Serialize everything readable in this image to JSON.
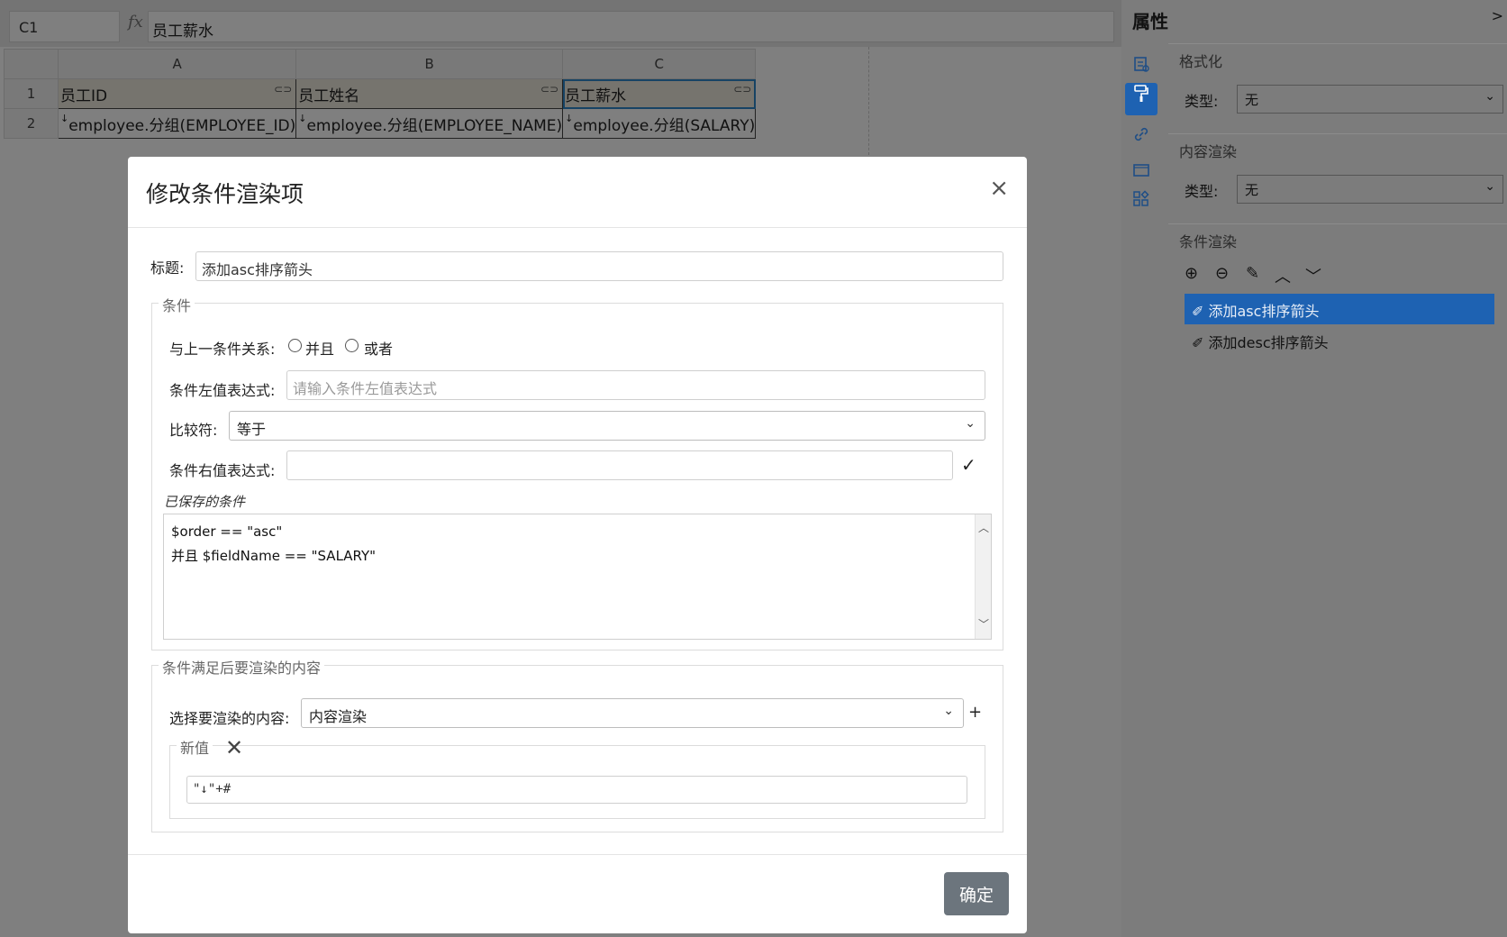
{
  "formula_bar": {
    "cell_ref": "C1",
    "fx": "fx",
    "formula": "员工薪水"
  },
  "sheet": {
    "columns": [
      "A",
      "B",
      "C"
    ],
    "row_numbers": [
      "1",
      "2"
    ],
    "rows": [
      [
        "员工ID",
        "员工姓名",
        "员工薪水"
      ],
      [
        "employee.分组(EMPLOYEE_ID)",
        "employee.分组(EMPLOYEE_NAME)",
        "employee.分组(SALARY)"
      ]
    ],
    "cell_marker": "↓"
  },
  "panel": {
    "title": "属性",
    "collapse": ">",
    "format": {
      "section_title": "格式化",
      "type_label": "类型:",
      "type_value": "无"
    },
    "content_render": {
      "section_title": "内容渲染",
      "type_label": "类型:",
      "type_value": "无"
    },
    "cond_render": {
      "section_title": "条件渲染",
      "items": [
        "添加asc排序箭头",
        "添加desc排序箭头"
      ]
    }
  },
  "dialog": {
    "title": "修改条件渲染项",
    "close": "×",
    "title_field": {
      "label": "标题:",
      "value": "添加asc排序箭头"
    },
    "conditions": {
      "legend": "条件",
      "relation_label": "与上一条件关系:",
      "relation_and": "并且",
      "relation_or": "或者",
      "left_label": "条件左值表达式:",
      "left_placeholder": "请输入条件左值表达式",
      "comparator_label": "比较符:",
      "comparator_value": "等于",
      "right_label": "条件右值表达式:",
      "right_value": "",
      "confirm_mark": "✓",
      "saved_label": "已保存的条件",
      "saved_lines": [
        "$order == \"asc\"",
        "并且 $fieldName == \"SALARY\""
      ]
    },
    "render_content": {
      "legend": "条件满足后要渲染的内容",
      "select_label": "选择要渲染的内容:",
      "select_value": "内容渲染",
      "add": "+",
      "newvalue_legend": "新值",
      "newvalue_remove": "✕",
      "newvalue_value": "\"↓\"+#"
    },
    "ok_label": "确定"
  }
}
